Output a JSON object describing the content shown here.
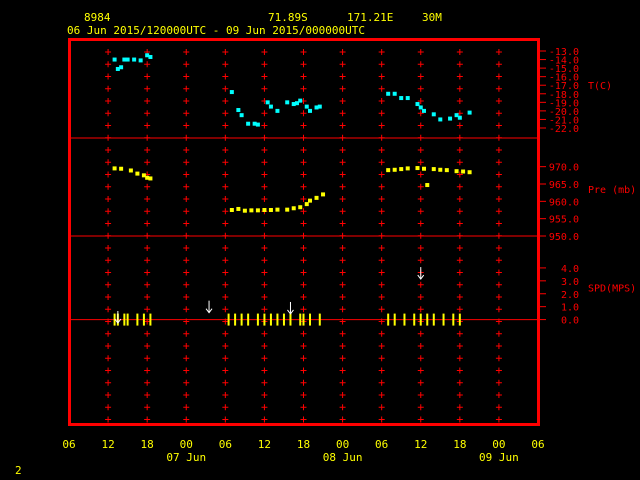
{
  "header": {
    "station_id": "8984",
    "latitude": "71.89S",
    "longitude": "171.21E",
    "interval": "30M",
    "time_range": "06 Jun 2015/120000UTC - 09 Jun 2015/000000UTC"
  },
  "footer": {
    "page_number": "2"
  },
  "colors": {
    "frame": "#ff0000",
    "axis_text": "#ff0000",
    "header_text": "#ffff00",
    "temperature": "#00ffff",
    "pressure": "#ffff00",
    "wind": "#ffff00",
    "wind_direction": "#ffffff",
    "background": "#000000"
  },
  "chart_data": {
    "type": "scatter",
    "x_axis": {
      "unit": "hours since 06 Jun 2015 00 UTC",
      "range": [
        6,
        78
      ],
      "tick_labels": [
        {
          "t": 6,
          "label": "06"
        },
        {
          "t": 12,
          "label": "12"
        },
        {
          "t": 18,
          "label": "18"
        },
        {
          "t": 24,
          "label": "00"
        },
        {
          "t": 30,
          "label": "06"
        },
        {
          "t": 36,
          "label": "12"
        },
        {
          "t": 42,
          "label": "18"
        },
        {
          "t": 48,
          "label": "00"
        },
        {
          "t": 54,
          "label": "06"
        },
        {
          "t": 60,
          "label": "12"
        },
        {
          "t": 66,
          "label": "18"
        },
        {
          "t": 72,
          "label": "00"
        },
        {
          "t": 78,
          "label": "06"
        }
      ],
      "day_labels": [
        {
          "t": 24,
          "label": "07 Jun"
        },
        {
          "t": 48,
          "label": "08 Jun"
        },
        {
          "t": 72,
          "label": "09 Jun"
        }
      ]
    },
    "panels": [
      {
        "name": "temperature",
        "label": "T(C)",
        "range": [
          -22.0,
          -13.0
        ],
        "tick_labels": [
          "-13.0",
          "-14.0",
          "-15.0",
          "-16.0",
          "-17.0",
          "-18.0",
          "-19.0",
          "-20.0",
          "-21.0",
          "-22.0"
        ],
        "label_at": -17.0,
        "series": [
          {
            "t": 13.0,
            "v": -14.0
          },
          {
            "t": 13.5,
            "v": -15.1
          },
          {
            "t": 14.0,
            "v": -14.9
          },
          {
            "t": 14.5,
            "v": -14.0
          },
          {
            "t": 15.0,
            "v": -14.0
          },
          {
            "t": 16.0,
            "v": -14.0
          },
          {
            "t": 17.0,
            "v": -14.1
          },
          {
            "t": 18.0,
            "v": -13.5
          },
          {
            "t": 18.5,
            "v": -13.7
          },
          {
            "t": 31.0,
            "v": -17.8
          },
          {
            "t": 32.0,
            "v": -19.9
          },
          {
            "t": 32.5,
            "v": -20.5
          },
          {
            "t": 33.5,
            "v": -21.5
          },
          {
            "t": 34.5,
            "v": -21.5
          },
          {
            "t": 35.0,
            "v": -21.6
          },
          {
            "t": 36.5,
            "v": -19.0
          },
          {
            "t": 37.0,
            "v": -19.5
          },
          {
            "t": 38.0,
            "v": -20.0
          },
          {
            "t": 39.5,
            "v": -19.0
          },
          {
            "t": 40.5,
            "v": -19.2
          },
          {
            "t": 41.0,
            "v": -19.1
          },
          {
            "t": 41.5,
            "v": -18.8
          },
          {
            "t": 42.5,
            "v": -19.5
          },
          {
            "t": 43.0,
            "v": -20.0
          },
          {
            "t": 44.0,
            "v": -19.6
          },
          {
            "t": 44.5,
            "v": -19.5
          },
          {
            "t": 55.0,
            "v": -18.0
          },
          {
            "t": 56.0,
            "v": -18.0
          },
          {
            "t": 57.0,
            "v": -18.5
          },
          {
            "t": 58.0,
            "v": -18.5
          },
          {
            "t": 59.5,
            "v": -19.2
          },
          {
            "t": 60.0,
            "v": -19.6
          },
          {
            "t": 60.5,
            "v": -20.0
          },
          {
            "t": 62.0,
            "v": -20.4
          },
          {
            "t": 63.0,
            "v": -21.0
          },
          {
            "t": 64.5,
            "v": -20.9
          },
          {
            "t": 65.5,
            "v": -20.5
          },
          {
            "t": 66.0,
            "v": -20.8
          },
          {
            "t": 67.5,
            "v": -20.2
          }
        ]
      },
      {
        "name": "pressure",
        "label": "Pre (mb)",
        "range": [
          950.0,
          972.5
        ],
        "tick_labels": [
          "970.0",
          "965.0",
          "960.0",
          "955.0",
          "950.0"
        ],
        "label_at": 963.5,
        "series": [
          {
            "t": 13.0,
            "v": 969.5
          },
          {
            "t": 14.0,
            "v": 969.4
          },
          {
            "t": 15.5,
            "v": 968.9
          },
          {
            "t": 16.5,
            "v": 968.0
          },
          {
            "t": 17.5,
            "v": 967.5
          },
          {
            "t": 18.0,
            "v": 966.8
          },
          {
            "t": 18.5,
            "v": 966.6
          },
          {
            "t": 31.0,
            "v": 957.5
          },
          {
            "t": 32.0,
            "v": 957.8
          },
          {
            "t": 33.0,
            "v": 957.3
          },
          {
            "t": 34.0,
            "v": 957.4
          },
          {
            "t": 35.0,
            "v": 957.4
          },
          {
            "t": 36.0,
            "v": 957.5
          },
          {
            "t": 37.0,
            "v": 957.5
          },
          {
            "t": 38.0,
            "v": 957.6
          },
          {
            "t": 39.5,
            "v": 957.6
          },
          {
            "t": 40.5,
            "v": 958.0
          },
          {
            "t": 41.5,
            "v": 958.3
          },
          {
            "t": 42.5,
            "v": 959.2
          },
          {
            "t": 43.0,
            "v": 960.2
          },
          {
            "t": 44.0,
            "v": 961.0
          },
          {
            "t": 45.0,
            "v": 962.0
          },
          {
            "t": 55.0,
            "v": 969.0
          },
          {
            "t": 56.0,
            "v": 969.1
          },
          {
            "t": 57.0,
            "v": 969.3
          },
          {
            "t": 58.0,
            "v": 969.5
          },
          {
            "t": 59.5,
            "v": 969.6
          },
          {
            "t": 60.5,
            "v": 969.4
          },
          {
            "t": 61.0,
            "v": 964.7
          },
          {
            "t": 62.0,
            "v": 969.3
          },
          {
            "t": 63.0,
            "v": 969.1
          },
          {
            "t": 64.0,
            "v": 969.0
          },
          {
            "t": 65.5,
            "v": 968.7
          },
          {
            "t": 66.5,
            "v": 968.6
          },
          {
            "t": 67.5,
            "v": 968.4
          }
        ]
      },
      {
        "name": "wind_speed",
        "label": "SPD(MPS)",
        "range": [
          -7.0,
          5.0
        ],
        "tick_labels": [
          "4.0",
          "3.0",
          "2.0",
          "1.0",
          "0.0"
        ],
        "label_at": 2.5,
        "baseline": 0.0,
        "calm_times": [
          13.0,
          13.5,
          14.5,
          15.0,
          16.5,
          17.5,
          18.5,
          30.5,
          31.5,
          32.5,
          33.5,
          35.0,
          36.0,
          37.0,
          38.0,
          39.0,
          40.0,
          41.5,
          42.0,
          43.0,
          44.5,
          55.0,
          56.0,
          57.5,
          59.0,
          60.0,
          61.0,
          62.0,
          63.5,
          65.0,
          66.0
        ],
        "direction_arrows": [
          {
            "t": 13.5,
            "v": 0.2
          },
          {
            "t": 27.5,
            "v": 1.0
          },
          {
            "t": 40.0,
            "v": 0.9
          },
          {
            "t": 60.0,
            "v": 3.6
          }
        ],
        "direction_arrow_style": "downward"
      }
    ]
  }
}
